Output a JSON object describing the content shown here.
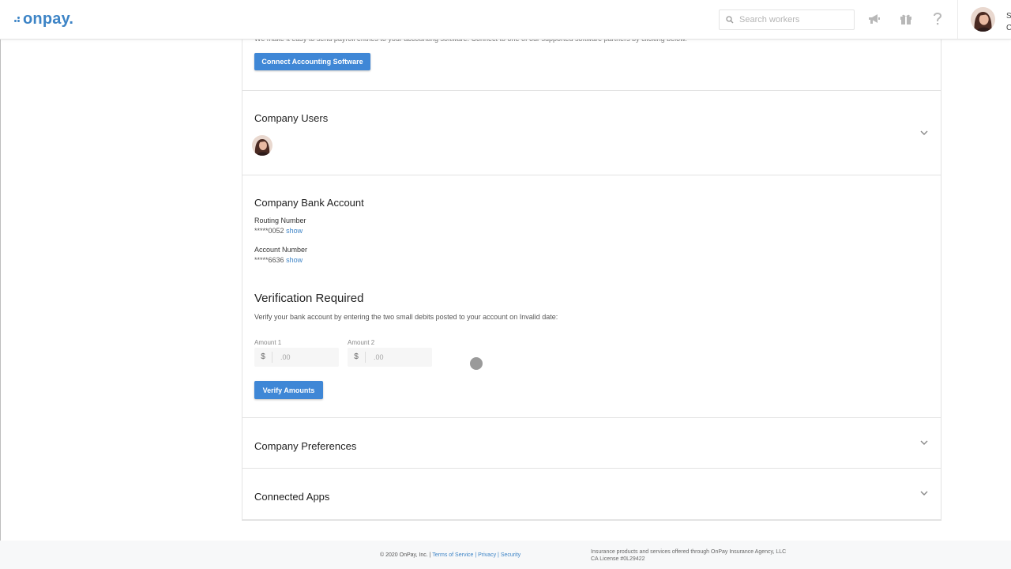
{
  "header": {
    "logo": "onpay.",
    "search_placeholder": "Search workers",
    "user_initial": "S",
    "user_sub": "C"
  },
  "accounting": {
    "intro": "We make it easy to send payroll entries to your accounting software. Connect to one of our supported software partners by clicking below.",
    "button": "Connect Accounting Software"
  },
  "users": {
    "title": "Company Users"
  },
  "bank": {
    "title": "Company Bank Account",
    "routing_label": "Routing Number",
    "routing_value": "*****0052",
    "account_label": "Account Number",
    "account_value": "*****6636",
    "show_link": "show"
  },
  "verification": {
    "title": "Verification Required",
    "description": "Verify your bank account by entering the two small debits posted to your account on Invalid date:",
    "amount1_label": "Amount 1",
    "amount2_label": "Amount 2",
    "currency": "$",
    "placeholder": ".00",
    "button": "Verify Amounts"
  },
  "preferences": {
    "title": "Company Preferences"
  },
  "apps": {
    "title": "Connected Apps"
  },
  "footer": {
    "copyright": "© 2020 OnPay, Inc. |",
    "terms": "Terms of Service",
    "sep1": "|",
    "privacy": "Privacy",
    "sep2": "|",
    "security": "Security",
    "insurance_line1": "Insurance products and services offered through OnPay Insurance Agency, LLC",
    "insurance_line2": "CA License #0L29422"
  },
  "colors": {
    "brand": "#3d84c6",
    "button": "#3f87d6",
    "border": "#e3e3e3"
  },
  "icons": [
    "search-icon",
    "megaphone-icon",
    "gift-icon",
    "help-icon",
    "chevron-down-icon"
  ]
}
